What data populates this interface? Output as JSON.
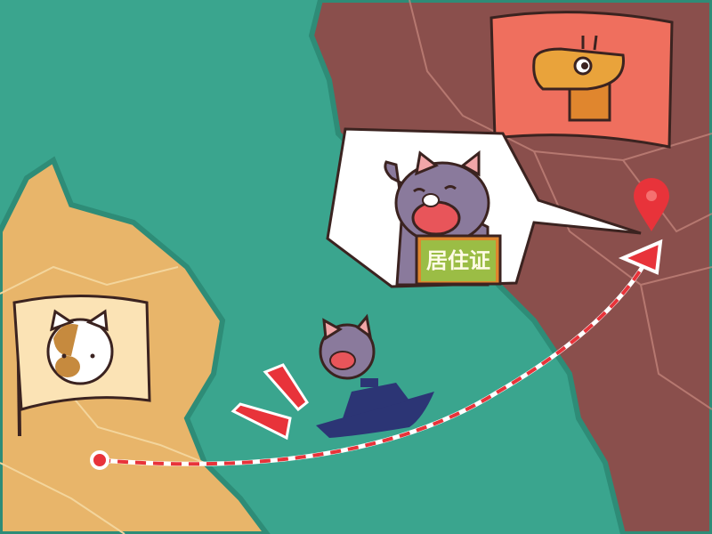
{
  "illustration": {
    "sign_text": "居住证",
    "colors": {
      "sea": "#3aa58e",
      "origin_land": "#e8b56a",
      "destination_land": "#8a4f4c",
      "route": "#e8333a",
      "ship": "#2c3575",
      "cat": "#8a7a9c",
      "sign": "#9bbd45"
    },
    "icons": [
      "cat-flag-icon",
      "giraffe-flag-icon",
      "map-pin-icon",
      "ship-icon",
      "exclamation-icon"
    ]
  }
}
